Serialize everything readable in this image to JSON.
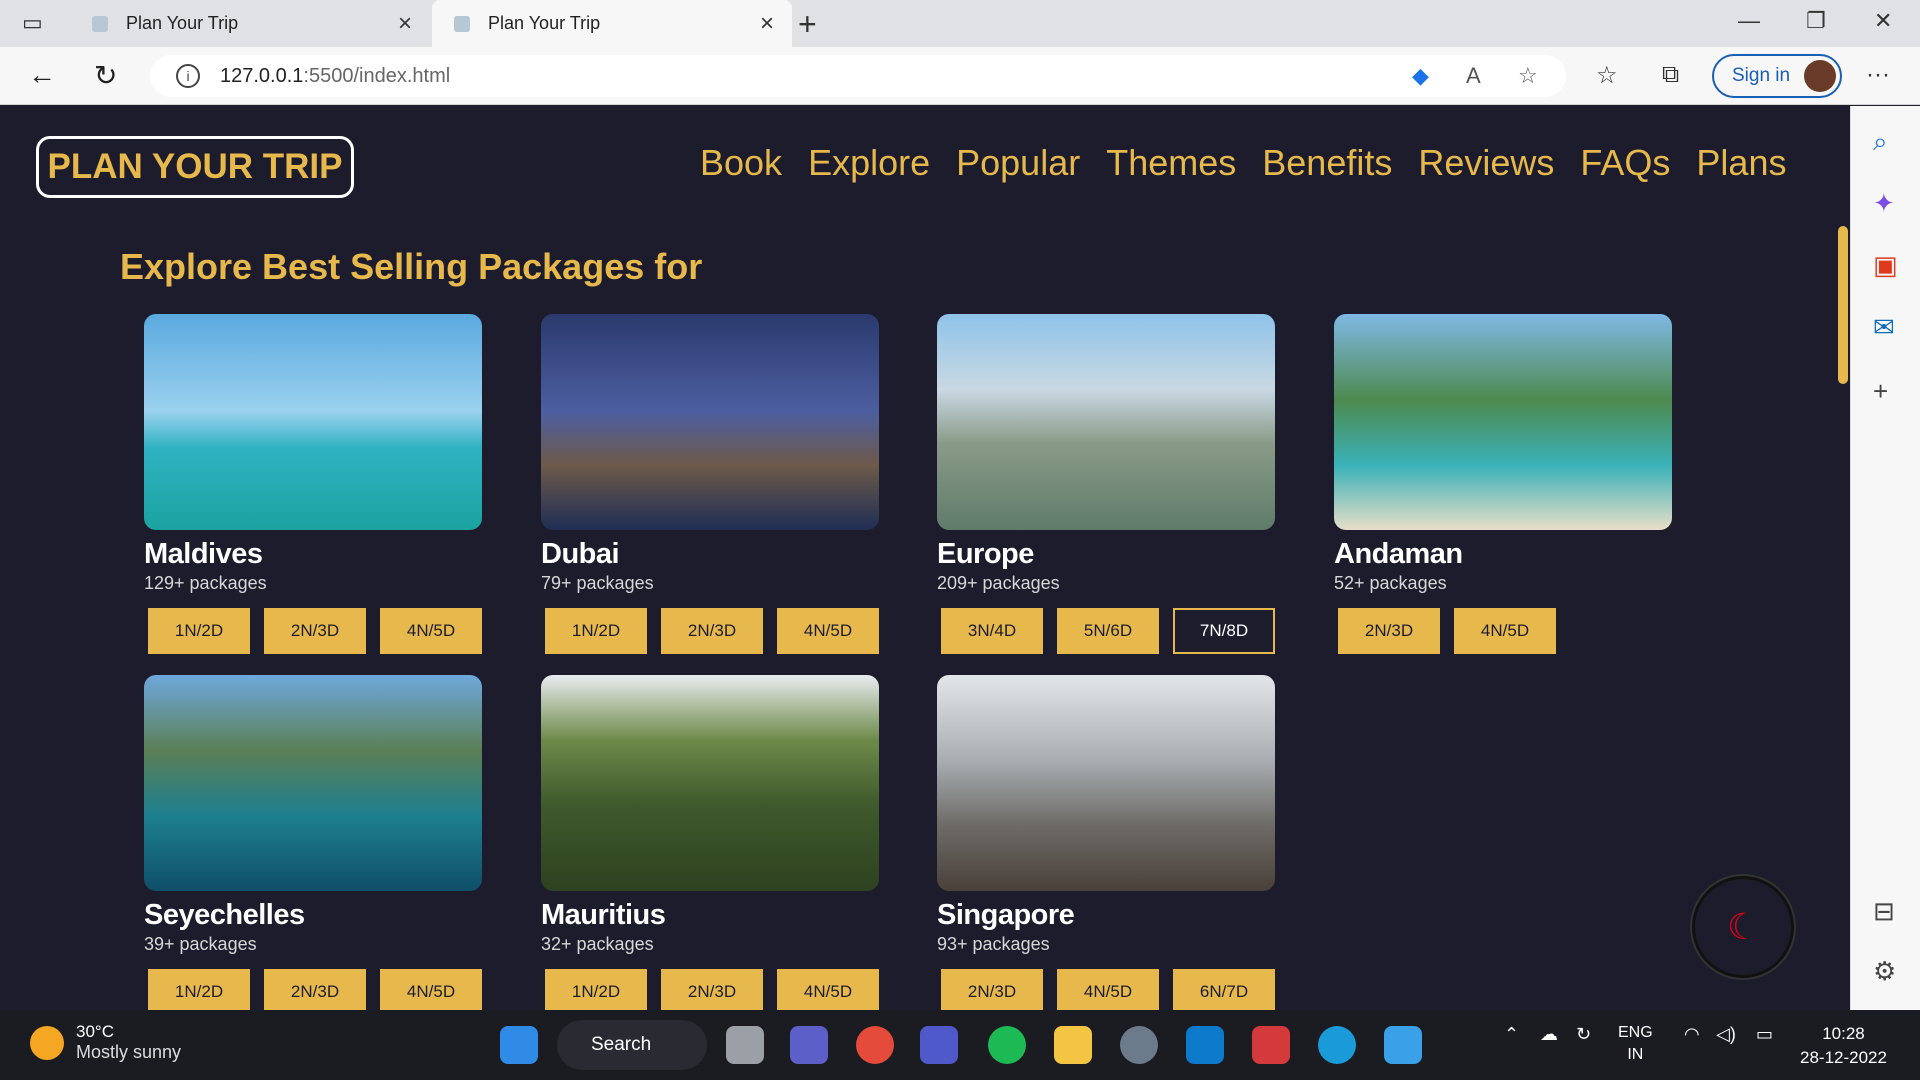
{
  "browser": {
    "tabs": [
      {
        "title": "Plan Your Trip",
        "active": false
      },
      {
        "title": "Plan Your Trip",
        "active": true
      }
    ],
    "url_host": "127.0.0.1",
    "url_rest": ":5500/index.html",
    "sign_in": "Sign in"
  },
  "site": {
    "logo": "PLAN YOUR TRIP",
    "nav": [
      "Book",
      "Explore",
      "Popular",
      "Themes",
      "Benefits",
      "Reviews",
      "FAQs",
      "Plans"
    ],
    "heading": "Explore Best Selling Packages for"
  },
  "packages": [
    {
      "name": "Maldives",
      "count": "129+ packages",
      "durations": [
        "1N/2D",
        "2N/3D",
        "4N/5D"
      ],
      "selected": null
    },
    {
      "name": "Dubai",
      "count": "79+ packages",
      "durations": [
        "1N/2D",
        "2N/3D",
        "4N/5D"
      ],
      "selected": null
    },
    {
      "name": "Europe",
      "count": "209+ packages",
      "durations": [
        "3N/4D",
        "5N/6D",
        "7N/8D"
      ],
      "selected": 2
    },
    {
      "name": "Andaman",
      "count": "52+ packages",
      "durations": [
        "2N/3D",
        "4N/5D"
      ],
      "selected": null
    },
    {
      "name": "Seyechelles",
      "count": "39+ packages",
      "durations": [
        "1N/2D",
        "2N/3D",
        "4N/5D"
      ],
      "selected": null
    },
    {
      "name": "Mauritius",
      "count": "32+ packages",
      "durations": [
        "1N/2D",
        "2N/3D",
        "4N/5D"
      ],
      "selected": null
    },
    {
      "name": "Singapore",
      "count": "93+ packages",
      "durations": [
        "2N/3D",
        "4N/5D",
        "6N/7D"
      ],
      "selected": null
    }
  ],
  "taskbar": {
    "temp": "30°C",
    "weather": "Mostly sunny",
    "search": "Search",
    "lang1": "ENG",
    "lang2": "IN",
    "time": "10:28",
    "date": "28-12-2022"
  },
  "colors": {
    "accent": "#e7b94c",
    "bg": "#1c1c2c"
  }
}
